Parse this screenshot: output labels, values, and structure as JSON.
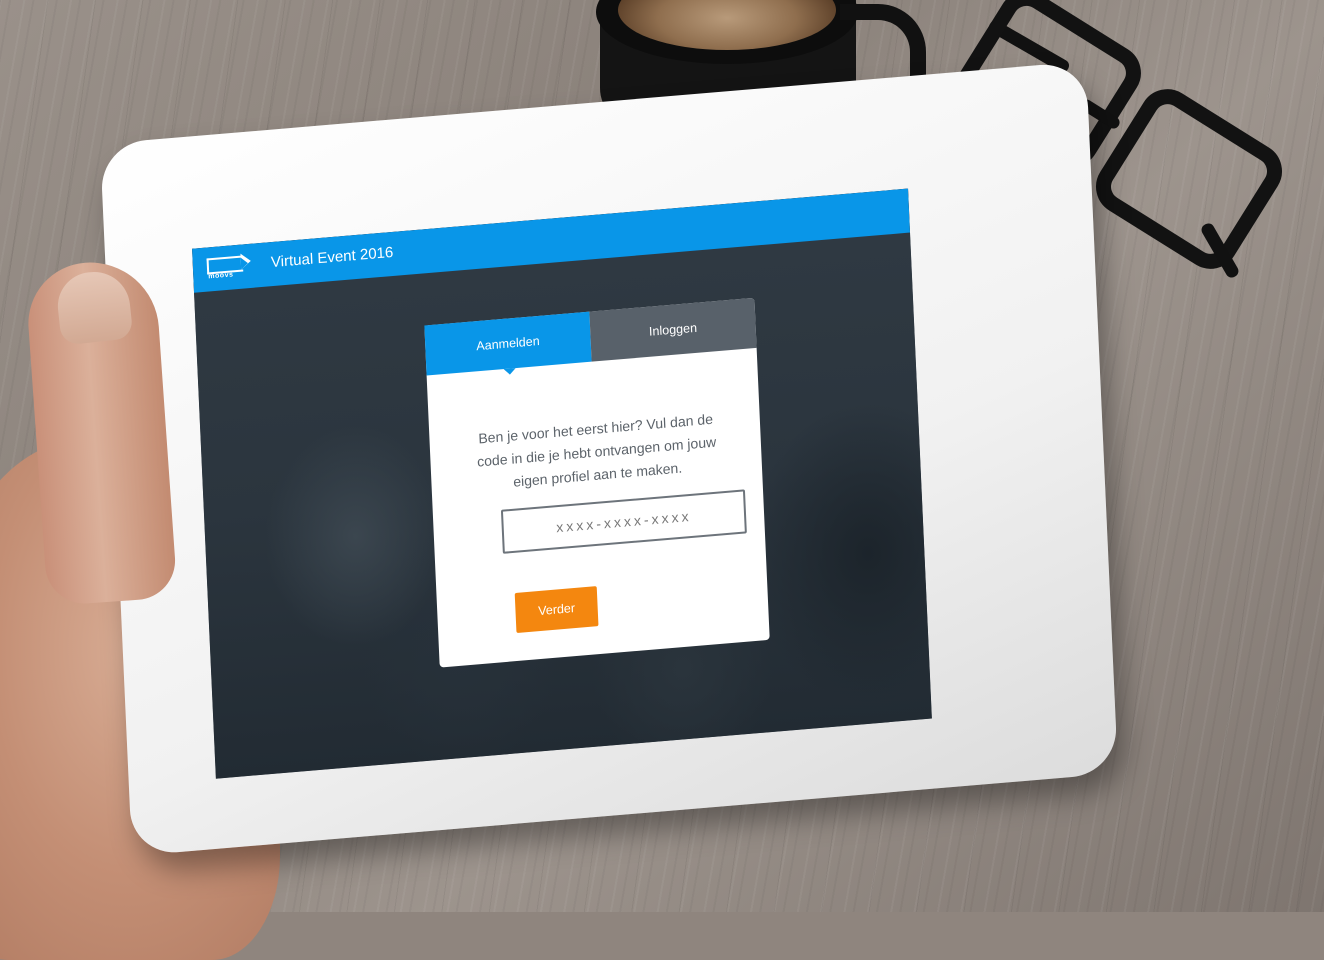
{
  "app": {
    "logo_text": "moovs",
    "title": "Virtual Event 2016"
  },
  "tabs": [
    {
      "label": "Aanmelden",
      "active": true
    },
    {
      "label": "Inloggen",
      "active": false
    }
  ],
  "signup": {
    "intro": "Ben je voor het eerst hier? Vul dan de code in die je hebt ontvangen om jouw eigen profiel aan te maken.",
    "code_placeholder": "xxxx-xxxx-xxxx",
    "code_value": "",
    "submit_label": "Verder"
  },
  "colors": {
    "primary": "#0996e8",
    "tab_inactive": "#58616a",
    "accent_button": "#f4870f"
  },
  "icons": {
    "logo": "moovs-tag-logo"
  }
}
